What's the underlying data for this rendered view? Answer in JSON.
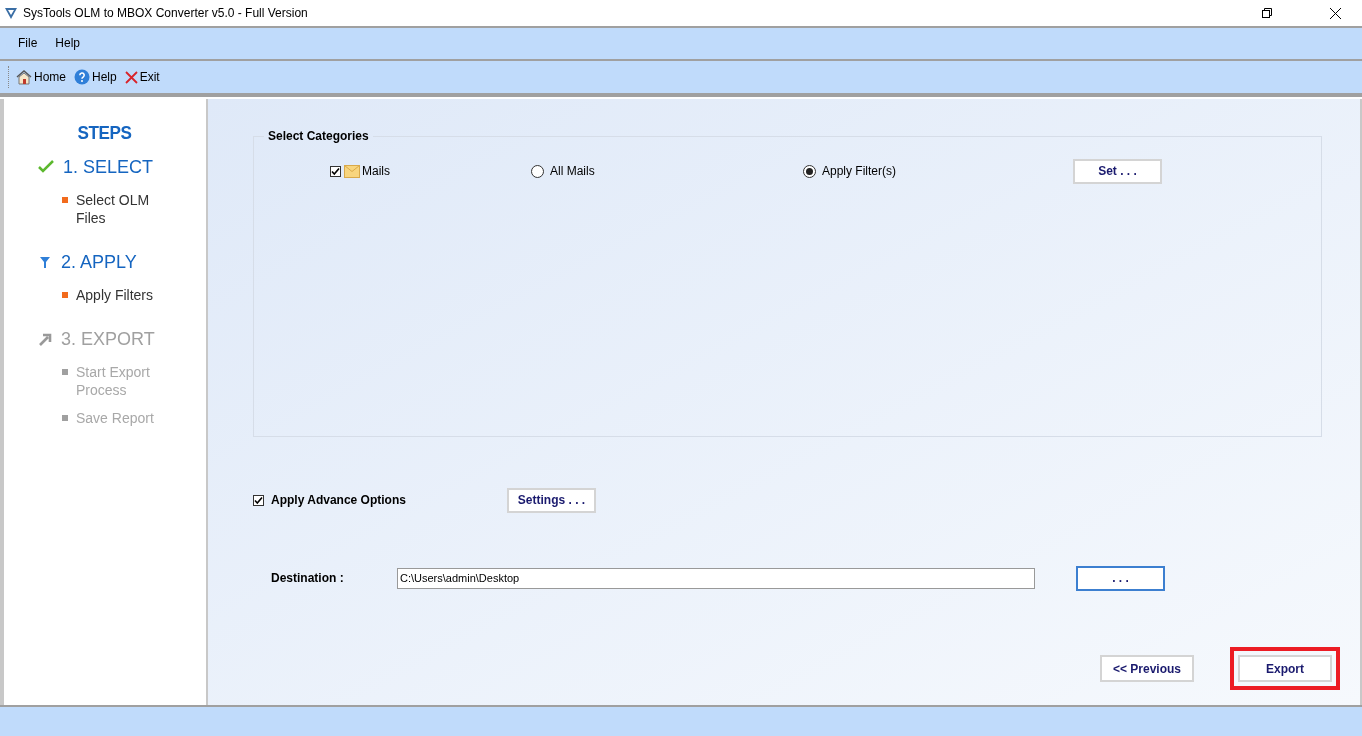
{
  "window": {
    "title": "SysTools OLM to MBOX Converter v5.0 - Full Version"
  },
  "menu": [
    "File",
    "Help"
  ],
  "toolbar": [
    {
      "kind": "home",
      "label": "Home"
    },
    {
      "kind": "help",
      "label": "Help"
    },
    {
      "kind": "exit",
      "label": "Exit"
    }
  ],
  "steps": {
    "heading": "STEPS",
    "items": [
      {
        "kind": "check",
        "label": "1. SELECT",
        "enabled": true,
        "subitems": [
          "Select OLM Files"
        ]
      },
      {
        "kind": "filter",
        "label": "2. APPLY",
        "enabled": true,
        "subitems": [
          "Apply Filters"
        ]
      },
      {
        "kind": "arrow",
        "label": "3. EXPORT",
        "enabled": false,
        "subitems": [
          "Start Export Process",
          "Save Report"
        ]
      }
    ]
  },
  "categories": {
    "title": "Select Categories",
    "mails": {
      "label": "Mails",
      "checked": true
    },
    "options": [
      {
        "label": "All Mails",
        "selected": false
      },
      {
        "label": "Apply Filter(s)",
        "selected": true
      }
    ],
    "set_button": "Set . . ."
  },
  "advance": {
    "label": "Apply Advance Options",
    "checked": true,
    "button": "Settings . . ."
  },
  "destination": {
    "label": "Destination :",
    "value": "C:\\Users\\admin\\Desktop",
    "browse_button": ". . ."
  },
  "buttons": [
    {
      "label": "<< Previous",
      "highlighted": false
    },
    {
      "label": "Export",
      "highlighted": true
    }
  ]
}
